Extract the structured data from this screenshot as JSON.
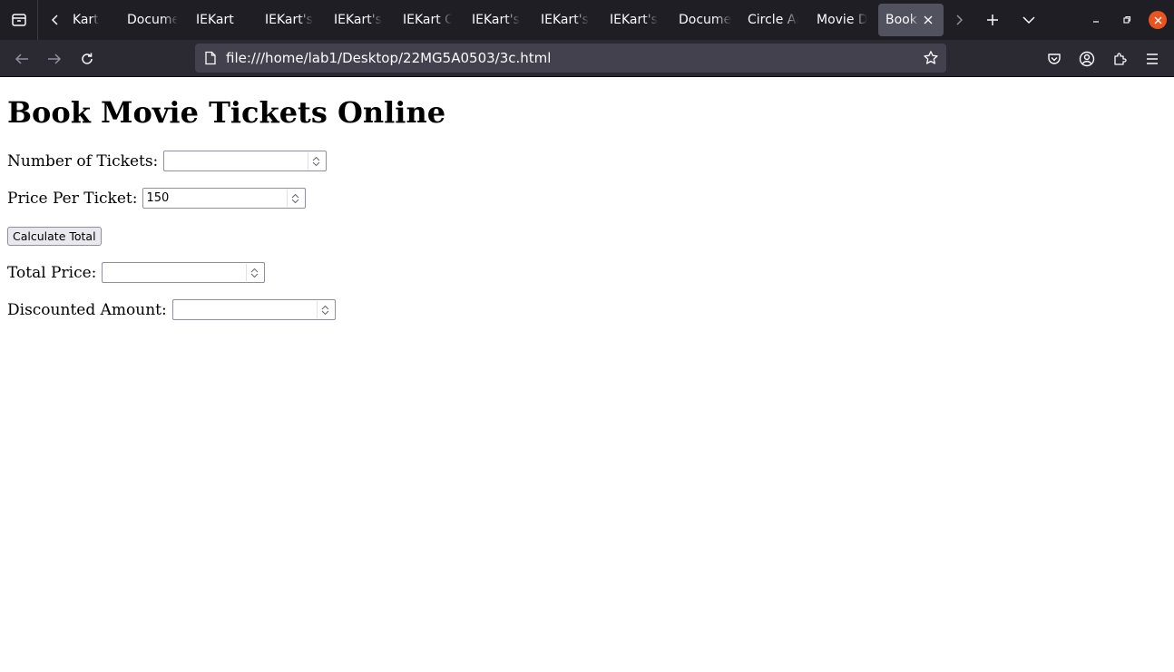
{
  "browser": {
    "tabs": [
      {
        "label": "Kart",
        "active": false
      },
      {
        "label": "Document",
        "active": false
      },
      {
        "label": "IEKart",
        "active": false
      },
      {
        "label": "IEKart's",
        "active": false
      },
      {
        "label": "IEKart's",
        "active": false
      },
      {
        "label": "IEKart C",
        "active": false
      },
      {
        "label": "IEKart's",
        "active": false
      },
      {
        "label": "IEKart's",
        "active": false
      },
      {
        "label": "IEKart's",
        "active": false
      },
      {
        "label": "Document",
        "active": false
      },
      {
        "label": "Circle Ar",
        "active": false
      },
      {
        "label": "Movie D",
        "active": false
      },
      {
        "label": "Book",
        "active": true
      }
    ],
    "url": "file:///home/lab1/Desktop/22MG5A0503/3c.html",
    "colors": {
      "tabstrip": "#1f1e25",
      "navbar": "#2b2a33",
      "urlbar": "#42414d",
      "active_tab": "#52525e",
      "window_close": "#e95420"
    }
  },
  "page": {
    "heading": "Book Movie Tickets Online",
    "fields": {
      "tickets": {
        "label": "Number of Tickets:",
        "value": ""
      },
      "price": {
        "label": "Price Per Ticket:",
        "value": "150"
      },
      "total": {
        "label": "Total Price:",
        "value": ""
      },
      "discount": {
        "label": "Discounted Amount:",
        "value": ""
      }
    },
    "calculate_button": "Calculate Total"
  }
}
